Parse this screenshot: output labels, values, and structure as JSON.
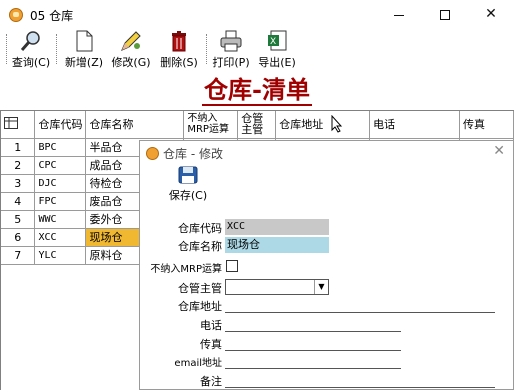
{
  "window": {
    "title": "05 仓库",
    "min_icon": "minimize-icon",
    "max_icon": "maximize-icon",
    "close_label": "✕"
  },
  "toolbar": {
    "query": "查询(C)",
    "new": "新增(Z)",
    "edit": "修改(G)",
    "delete": "删除(S)",
    "print": "打印(P)",
    "export": "导出(E)"
  },
  "heading": "仓库-清单",
  "grid": {
    "columns": [
      "仓库代码",
      "仓库名称",
      "不纳入MRP运算",
      "仓管主管",
      "仓库地址",
      "电话",
      "传真"
    ],
    "rows": [
      {
        "n": "1",
        "code": "BPC",
        "name": "半品仓"
      },
      {
        "n": "2",
        "code": "CPC",
        "name": "成品仓"
      },
      {
        "n": "3",
        "code": "DJC",
        "name": "待检仓"
      },
      {
        "n": "4",
        "code": "FPC",
        "name": "废品仓"
      },
      {
        "n": "5",
        "code": "WWC",
        "name": "委外仓"
      },
      {
        "n": "6",
        "code": "XCC",
        "name": "现场仓"
      },
      {
        "n": "7",
        "code": "YLC",
        "name": "原料仓"
      }
    ],
    "selected_row": 6
  },
  "dialog": {
    "title": "仓库 - 修改",
    "close": "✕",
    "save": "保存(C)",
    "labels": {
      "code": "仓库代码",
      "name": "仓库名称",
      "mrp": "不纳入MRP运算",
      "manager": "仓管主管",
      "address": "仓库地址",
      "phone": "电话",
      "fax": "传真",
      "email": "email地址",
      "note": "备注"
    },
    "values": {
      "code": "XCC",
      "name": "现场仓",
      "mrp_checked": false,
      "manager": "",
      "address": "",
      "phone": "",
      "fax": "",
      "email": "",
      "note": ""
    }
  },
  "colors": {
    "heading": "#a00000",
    "selected_row": "#f0b830",
    "name_field": "#add8e6",
    "code_field": "#c8c8c8"
  }
}
